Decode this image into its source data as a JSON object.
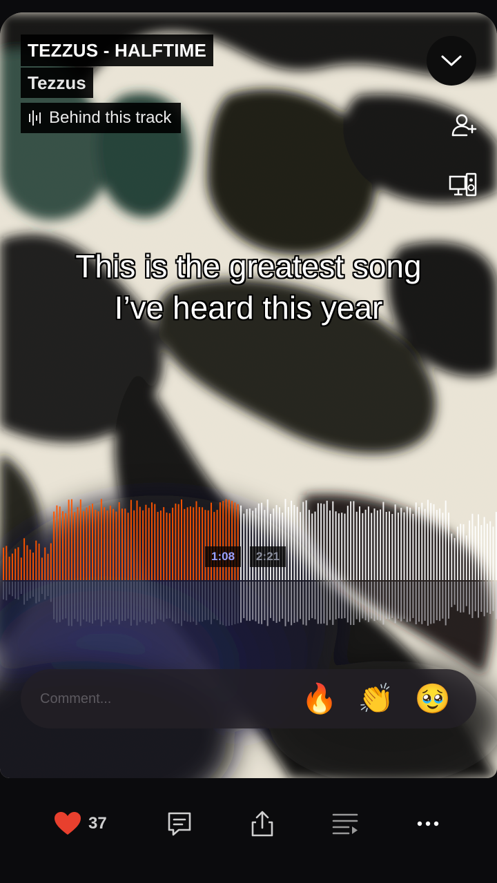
{
  "track": {
    "title": "TEZZUS - HALFTIME",
    "artist": "Tezzus",
    "behind_track_label": "Behind this track"
  },
  "caption": {
    "line1": "This is the greatest song",
    "line2": "I’ve heard this year"
  },
  "player": {
    "current_time": "1:08",
    "total_time": "2:21",
    "progress_fraction": 0.48,
    "played_color": "#ff5500",
    "unplayed_color": "#ffffff"
  },
  "comment": {
    "placeholder": "Comment...",
    "quick_reactions": [
      "🔥",
      "👏",
      "🥹"
    ]
  },
  "actions": {
    "like_count": "37",
    "like_color": "#e8402e"
  },
  "icons": {
    "collapse": "chevron-down-icon",
    "follow": "add-user-icon",
    "devices": "cast-devices-icon",
    "behind_track": "waveform-icon",
    "like": "heart-icon",
    "comments": "comment-icon",
    "share": "share-icon",
    "queue": "queue-icon",
    "more": "more-icon"
  }
}
